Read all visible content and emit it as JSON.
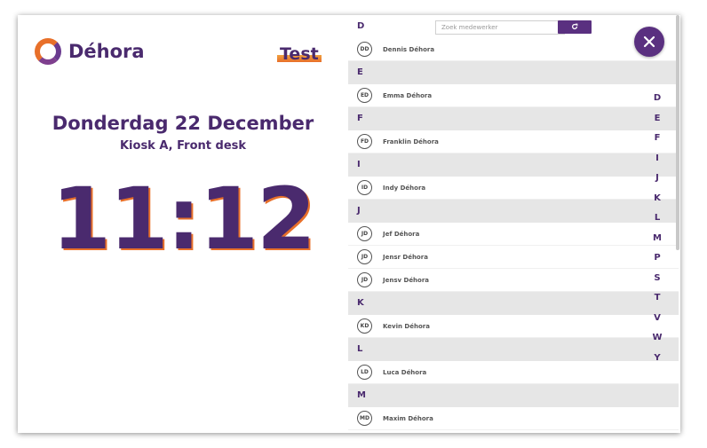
{
  "brand": {
    "name": "Déhora"
  },
  "environment": {
    "label": "Test"
  },
  "kiosk": {
    "date": "Donderdag 22 December",
    "location": "Kiosk A, Front desk",
    "time": "11:12"
  },
  "search": {
    "placeholder": "Zoek medewerker",
    "refresh_icon": "refresh-icon"
  },
  "employees": [
    {
      "letter": "D",
      "people": [
        {
          "initials": "DD",
          "name": "Dennis Déhora"
        }
      ]
    },
    {
      "letter": "E",
      "people": [
        {
          "initials": "ED",
          "name": "Emma Déhora"
        }
      ]
    },
    {
      "letter": "F",
      "people": [
        {
          "initials": "FD",
          "name": "Franklin Déhora"
        }
      ]
    },
    {
      "letter": "I",
      "people": [
        {
          "initials": "ID",
          "name": "Indy Déhora"
        }
      ]
    },
    {
      "letter": "J",
      "people": [
        {
          "initials": "JD",
          "name": "Jef Déhora"
        },
        {
          "initials": "JD",
          "name": "Jensr Déhora"
        },
        {
          "initials": "JD",
          "name": "Jensv Déhora"
        }
      ]
    },
    {
      "letter": "K",
      "people": [
        {
          "initials": "KD",
          "name": "Kevin Déhora"
        }
      ]
    },
    {
      "letter": "L",
      "people": [
        {
          "initials": "LD",
          "name": "Luca Déhora"
        }
      ]
    },
    {
      "letter": "M",
      "people": [
        {
          "initials": "MD",
          "name": "Maxim Déhora"
        }
      ]
    }
  ],
  "alphabet_index": [
    "D",
    "E",
    "F",
    "I",
    "J",
    "K",
    "L",
    "M",
    "P",
    "S",
    "T",
    "V",
    "W",
    "Y"
  ],
  "colors": {
    "brand_purple": "#4a2a6e",
    "accent_orange": "#e8702a",
    "button_purple": "#5a3080"
  }
}
